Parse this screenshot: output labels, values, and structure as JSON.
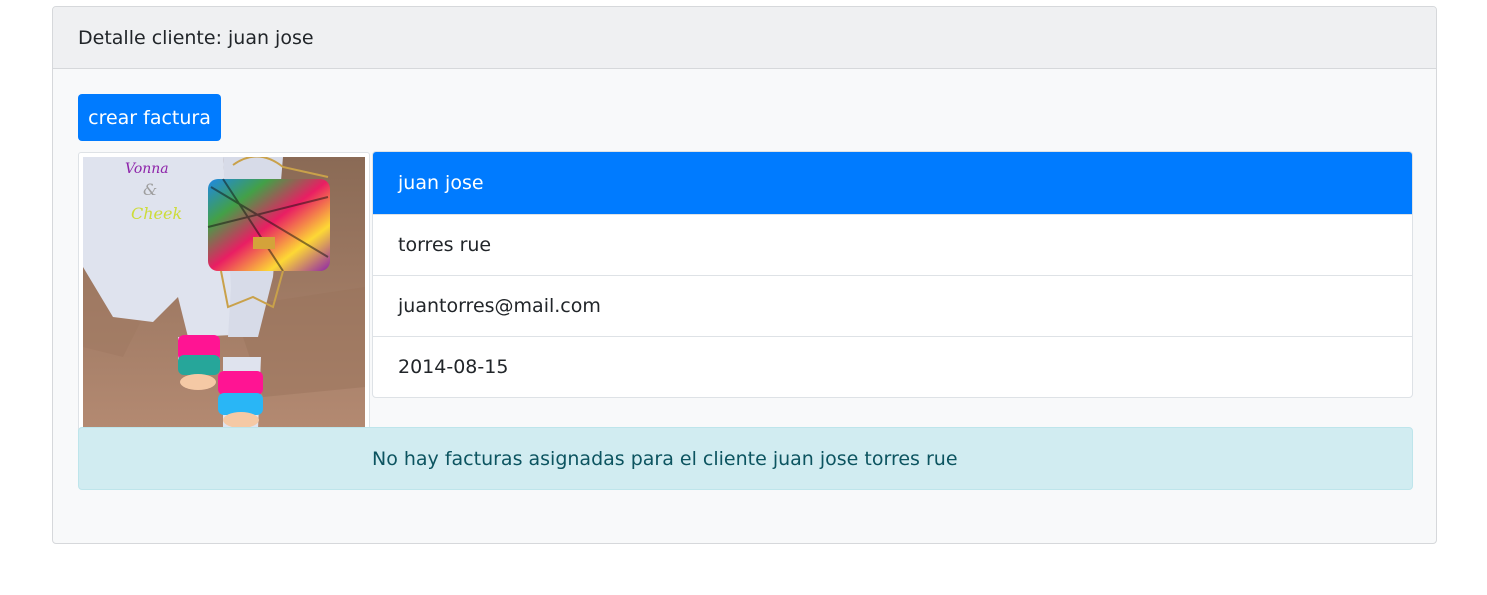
{
  "card": {
    "header_title": "Detalle cliente: juan jose"
  },
  "actions": {
    "create_invoice_label": "crear factura"
  },
  "photo": {
    "alt": "foto cliente"
  },
  "client": {
    "name": "juan jose",
    "surname": "torres rue",
    "email": "juantorres@mail.com",
    "created_at": "2014-08-15"
  },
  "alert": {
    "message": "No hay facturas asignadas para el cliente juan jose torres rue"
  },
  "colors": {
    "primary": "#007bff",
    "info_bg": "#d1ecf1",
    "info_text": "#0c5460",
    "card_bg": "#f8f9fa",
    "header_bg": "#eff0f2"
  }
}
